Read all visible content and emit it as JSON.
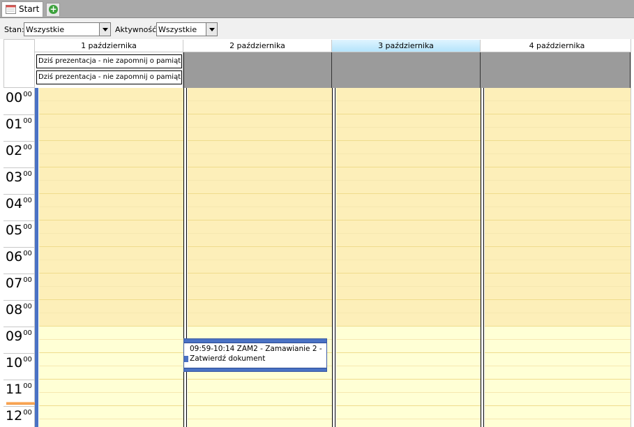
{
  "tabs": {
    "start_label": "Start"
  },
  "filters": {
    "stan_label": "Stan:",
    "stan_value": "Wszystkie",
    "aktywnosc_label": "Aktywność:",
    "aktywnosc_value": "Wszystkie"
  },
  "days": [
    {
      "label": "1 października"
    },
    {
      "label": "2 października"
    },
    {
      "label": "3 października"
    },
    {
      "label": "4 października"
    }
  ],
  "allday_items": [
    "Dziś prezentacja - nie zapomnij o pamiątko",
    "Dziś prezentacja - nie zapomnij o pamiątko"
  ],
  "hours": [
    "00",
    "01",
    "02",
    "03",
    "04",
    "05",
    "06",
    "07",
    "08",
    "09",
    "10",
    "11",
    "12"
  ],
  "minutes_label": "00",
  "event": {
    "text": "09:59-10:14 ZAM2 - Zamawianie 2 - Zatwierdź dokument"
  },
  "colors": {
    "today_header": "#b5e4fb",
    "work_hours_bg": "#ffffd5",
    "off_hours_bg": "#fdefb9",
    "event_border": "#4a72c4"
  }
}
